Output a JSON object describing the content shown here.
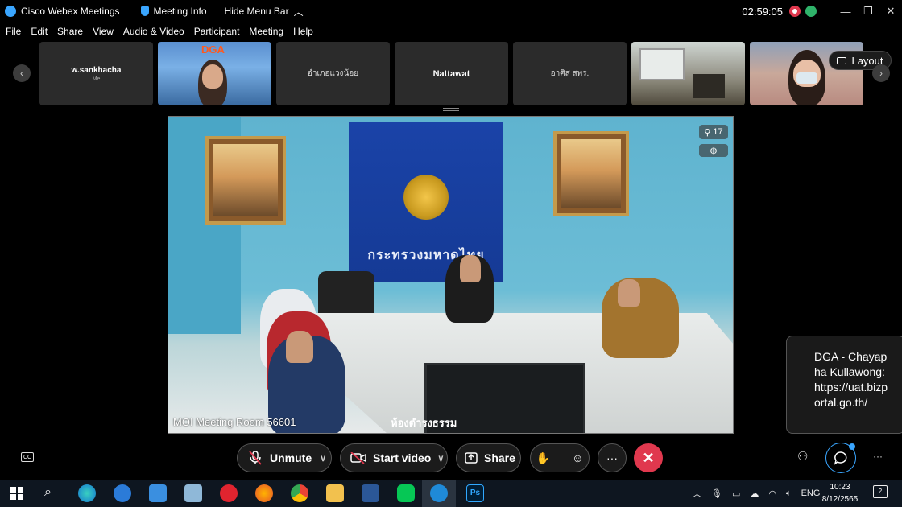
{
  "titlebar": {
    "app_name": "Cisco Webex Meetings",
    "meeting_info": "Meeting Info",
    "hide_menu_bar": "Hide Menu Bar",
    "elapsed_time": "02:59:05"
  },
  "menu": {
    "items": [
      "File",
      "Edit",
      "Share",
      "View",
      "Audio & Video",
      "Participant",
      "Meeting",
      "Help"
    ]
  },
  "participants": [
    {
      "name": "w.sankhacha",
      "sub": "Me"
    },
    {
      "name": "DGA",
      "type": "video"
    },
    {
      "name": "อำเภอแวงน้อย"
    },
    {
      "name": "Nattawat"
    },
    {
      "name": "อาศิส สพร."
    },
    {
      "name": "",
      "type": "video"
    },
    {
      "name": "",
      "type": "video"
    }
  ],
  "layout_button": "Layout",
  "main_video": {
    "label": "MOI Meeting Room 56601",
    "participant_count": "17",
    "sign_text": "กระทรวงมหาดไทย",
    "room_sign": "ห้องดำรงธรรม"
  },
  "chat_popup": {
    "text": "DGA - Chayapha Kullawong: https://uat.bizportal.go.th/"
  },
  "controls": {
    "unmute": "Unmute",
    "start_video": "Start video",
    "share": "Share",
    "more": "···",
    "end": "✕"
  },
  "taskbar": {
    "language": "ENG",
    "time": "10:23",
    "date": "8/12/2565",
    "notifications": "2"
  },
  "colors": {
    "accent": "#3aa6ff",
    "end_call": "#e0384e",
    "recording": "#e0384e",
    "network": "#2fb36a"
  }
}
